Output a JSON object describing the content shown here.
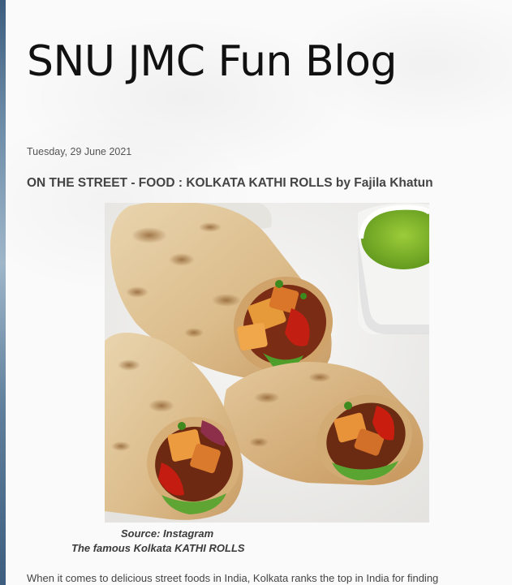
{
  "blog": {
    "title": "SNU JMC Fun Blog"
  },
  "post": {
    "date": "Tuesday, 29 June 2021",
    "title": "ON THE STREET - FOOD : KOLKATA KATHI ROLLS by Fajila Khatun",
    "image": {
      "subject": "kathi-rolls-photo"
    },
    "caption_source": "Source: Instagram",
    "caption_title": "The famous Kolkata KATHI ROLLS",
    "body_first_line": "When it comes to delicious street foods in India, Kolkata ranks the top in India for finding"
  },
  "colors": {
    "page_background": "#fafafa",
    "title_text": "#111111",
    "post_title_text": "#444444",
    "body_text": "#444444",
    "left_strip": "#5f7f9c"
  }
}
